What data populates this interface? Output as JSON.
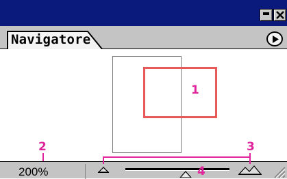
{
  "panel": {
    "tab_label": "Navigatore",
    "zoom_value": "200%"
  },
  "callouts": {
    "c1": "1",
    "c2": "2",
    "c3": "3",
    "c4": "4"
  },
  "colors": {
    "titlebar": "#0a1a7c",
    "view_rect": "#e85a5a",
    "callout": "#e0259c",
    "panel_gray": "#c4c4c4"
  },
  "icons": {
    "minimize": "minimize-icon",
    "close": "close-icon",
    "panel_menu": "play-menu-icon",
    "zoom_out": "small-mountain-icon",
    "zoom_in": "large-mountain-icon",
    "resize": "resize-grip-icon"
  }
}
